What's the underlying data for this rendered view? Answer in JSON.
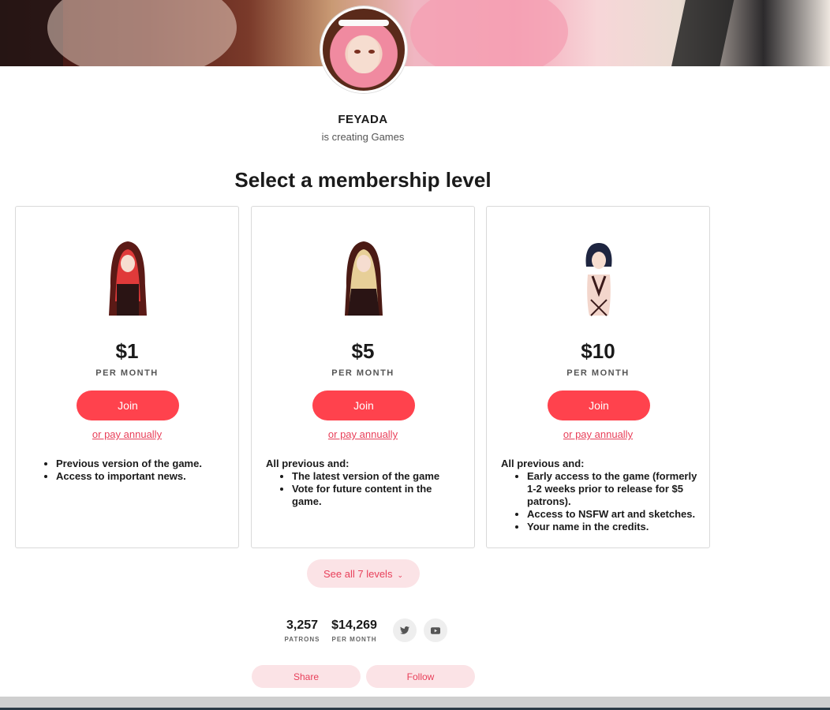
{
  "creator": {
    "name": "FEYADA",
    "subtitle": "is creating Games"
  },
  "section_title": "Select a membership level",
  "tiers": [
    {
      "price": "$1",
      "period": "PER MONTH",
      "join_label": "Join",
      "annual_label": "or pay annually",
      "intro": "",
      "benefits": [
        "Previous version of the game.",
        "Access to important news."
      ]
    },
    {
      "price": "$5",
      "period": "PER MONTH",
      "join_label": "Join",
      "annual_label": "or pay annually",
      "intro": "All previous and:",
      "benefits": [
        "The latest version of the game",
        "Vote for future content in the game."
      ]
    },
    {
      "price": "$10",
      "period": "PER MONTH",
      "join_label": "Join",
      "annual_label": "or pay annually",
      "intro": "All previous and:",
      "benefits": [
        "Early access to the game (formerly 1-2 weeks prior to release for $5 patrons).",
        "Access to NSFW art and sketches.",
        "Your name in the credits."
      ]
    }
  ],
  "see_all_label": "See all 7 levels",
  "stats": {
    "patrons_value": "3,257",
    "patrons_label": "PATRONS",
    "income_value": "$14,269",
    "income_label": "PER MONTH"
  },
  "social": {
    "twitter_icon": "twitter-icon",
    "youtube_icon": "youtube-icon"
  },
  "actions": {
    "share_label": "Share",
    "follow_label": "Follow"
  },
  "colors": {
    "accent": "#ff424d",
    "accent_text": "#e8405a",
    "pill_bg": "#fbe3e6"
  }
}
